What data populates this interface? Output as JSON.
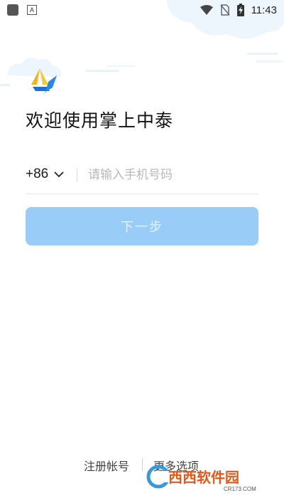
{
  "status_bar": {
    "time": "11:43",
    "left_icons": [
      "app-notification-icon",
      "text-a-icon"
    ],
    "right_icons": [
      "wifi-icon",
      "no-sim-icon",
      "battery-charging-icon"
    ]
  },
  "app": {
    "logo_icon": "zhongtai-logo-icon",
    "welcome_title": "欢迎使用掌上中泰"
  },
  "login": {
    "country_code": "+86",
    "phone_placeholder": "请输入手机号码",
    "phone_value": "",
    "next_label": "下一步"
  },
  "footer": {
    "register_label": "注册帐号",
    "more_options_label": "更多选项"
  },
  "watermark": {
    "brand": "西西软件园",
    "url": "CR173.COM"
  },
  "colors": {
    "accent_disabled": "#99cdf8",
    "logo_yellow": "#f2b51c",
    "logo_blue": "#1f6fd6",
    "cloud": "#eaf4fd"
  }
}
